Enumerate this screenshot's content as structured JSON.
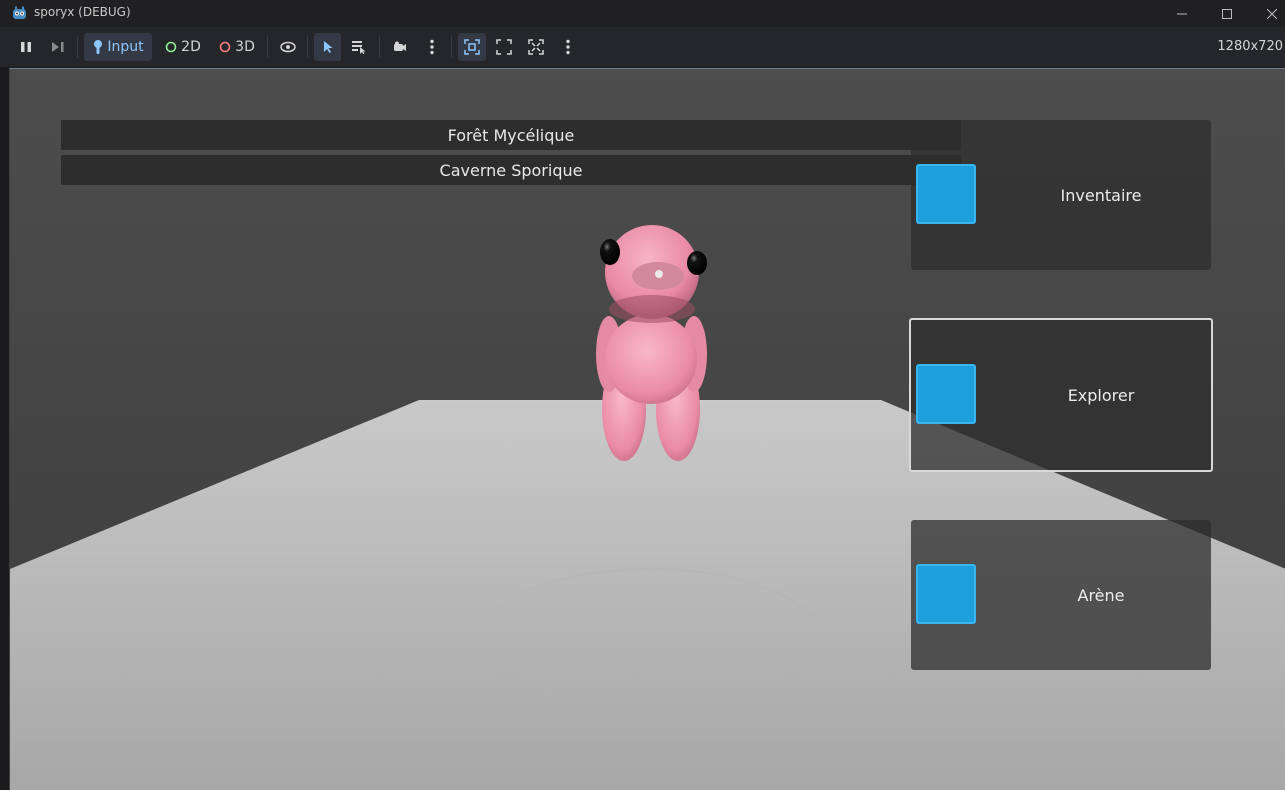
{
  "window": {
    "title": "sporyx (DEBUG)"
  },
  "toolbar": {
    "input_label": "Input",
    "mode_2d_label": "2D",
    "mode_3d_label": "3D",
    "resolution": "1280x720"
  },
  "scene": {
    "locations": [
      "Forêt Mycélique",
      "Caverne Sporique"
    ],
    "menu": [
      {
        "label": "Inventaire"
      },
      {
        "label": "Explorer"
      },
      {
        "label": "Arène"
      }
    ]
  },
  "colors": {
    "accent": "#1ea0dc",
    "creature": "#ee9bb3",
    "floor": "#b4b4b4",
    "background": "#4a4a4a"
  }
}
